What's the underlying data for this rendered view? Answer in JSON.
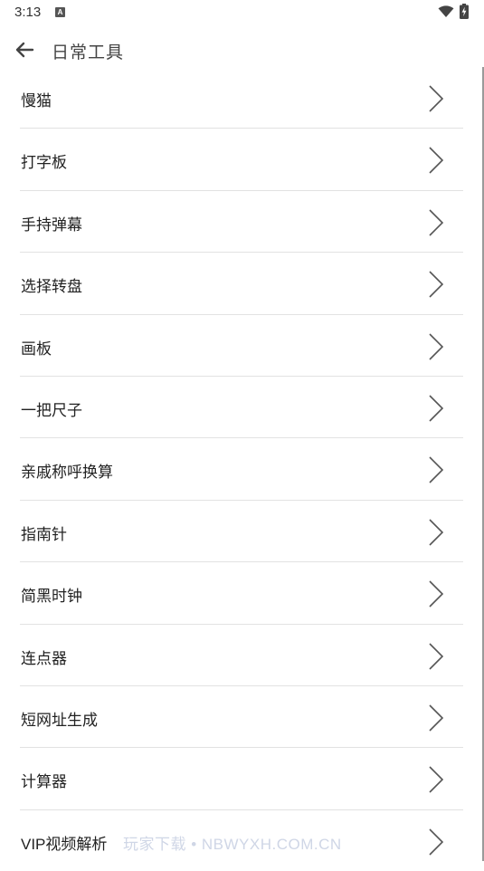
{
  "status_bar": {
    "time": "3:13",
    "notification_icon": "A"
  },
  "header": {
    "title": "日常工具",
    "back_icon": "arrow-left-icon"
  },
  "tools": [
    {
      "label": "慢猫"
    },
    {
      "label": "打字板"
    },
    {
      "label": "手持弹幕"
    },
    {
      "label": "选择转盘"
    },
    {
      "label": "画板"
    },
    {
      "label": "一把尺子"
    },
    {
      "label": "亲戚称呼换算"
    },
    {
      "label": "指南针"
    },
    {
      "label": "简黑时钟"
    },
    {
      "label": "连点器"
    },
    {
      "label": "短网址生成"
    },
    {
      "label": "计算器"
    },
    {
      "label": "VIP视频解析"
    }
  ],
  "watermark": "玩家下载 • NBWYXH.COM.CN"
}
